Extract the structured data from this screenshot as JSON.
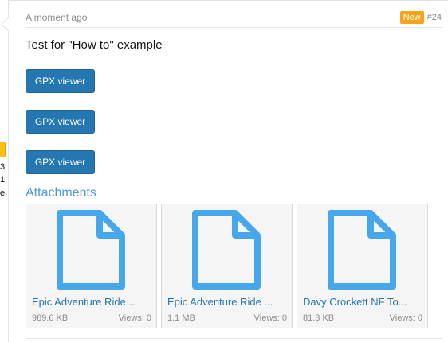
{
  "left_column": {
    "fragments": [
      "3",
      "1",
      "e"
    ],
    "badge_color": "#f9c013"
  },
  "post": {
    "timestamp": "A moment ago",
    "new_badge": "New",
    "post_number": "#24",
    "text": "Test for \"How to\" example",
    "buttons": [
      {
        "label": "GPX viewer"
      },
      {
        "label": "GPX viewer"
      },
      {
        "label": "GPX viewer"
      }
    ]
  },
  "attachments": {
    "title": "Attachments",
    "items": [
      {
        "name": "Epic Adventure Ride ...",
        "size": "989.6 KB",
        "views": "Views: 0",
        "icon": "file-icon"
      },
      {
        "name": "Epic Adventure Ride ...",
        "size": "1.1 MB",
        "views": "Views: 0",
        "icon": "file-icon"
      },
      {
        "name": "Davy Crockett NF To...",
        "size": "81.3 KB",
        "views": "Views: 0",
        "icon": "file-icon"
      }
    ]
  },
  "colors": {
    "button": "#2577b1",
    "link": "#2577b1",
    "heading": "#4a9ad4",
    "file_icon": "#47a7eb",
    "new_badge": "#f7a31a"
  }
}
